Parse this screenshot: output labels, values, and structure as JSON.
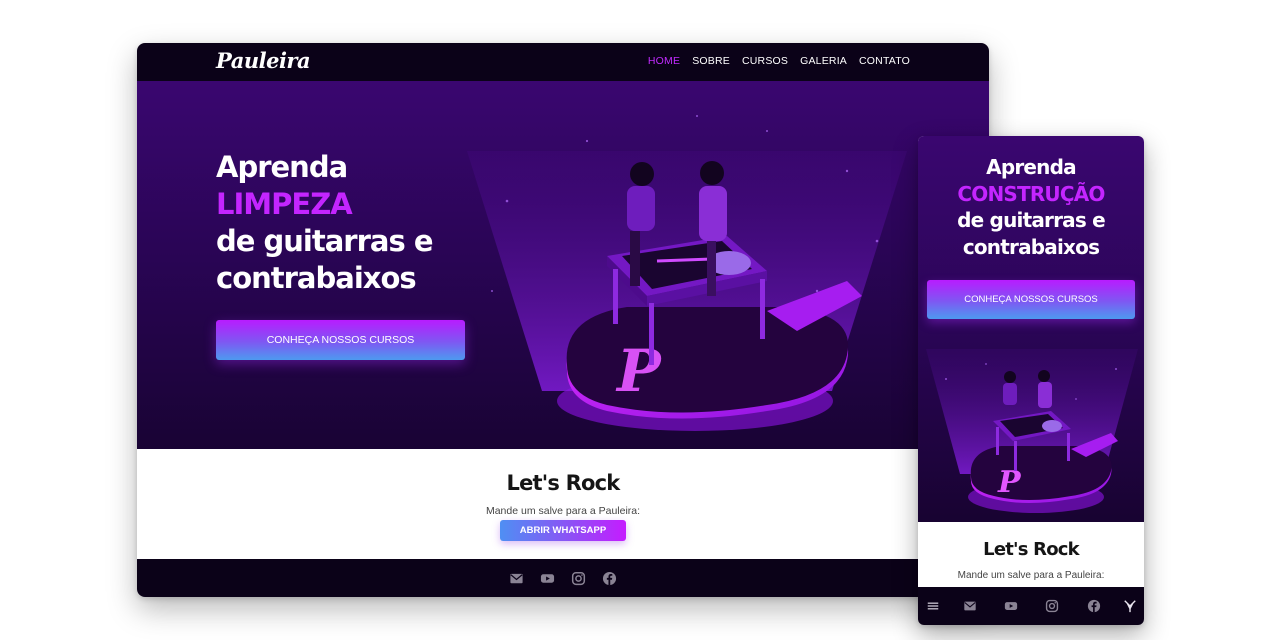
{
  "desktop": {
    "brand": "Pauleira",
    "nav": [
      {
        "label": "HOME",
        "active": true
      },
      {
        "label": "SOBRE",
        "active": false
      },
      {
        "label": "CURSOS",
        "active": false
      },
      {
        "label": "GALERIA",
        "active": false
      },
      {
        "label": "CONTATO",
        "active": false
      }
    ],
    "hero": {
      "line1": "Aprenda",
      "highlight": "LIMPEZA",
      "line3": "de guitarras e",
      "line4": "contrabaixos",
      "cta": "CONHEÇA NOSSOS CURSOS"
    },
    "contact": {
      "title": "Let's Rock",
      "subtitle": "Mande um salve para a Pauleira:",
      "button": "ABRIR WHATSAPP"
    },
    "footer_icons": [
      "mail-icon",
      "youtube-icon",
      "instagram-icon",
      "facebook-icon"
    ]
  },
  "mobile": {
    "hero": {
      "line1": "Aprenda",
      "highlight": "CONSTRUÇÃO",
      "line3": "de guitarras e",
      "line4": "contrabaixos",
      "cta": "CONHEÇA NOSSOS CURSOS"
    },
    "contact": {
      "title": "Let's Rock",
      "subtitle": "Mande um salve para a Pauleira:"
    },
    "footer_icons": [
      "menu-icon",
      "mail-icon",
      "youtube-icon",
      "instagram-icon",
      "facebook-icon",
      "brand-mark-icon"
    ]
  },
  "colors": {
    "accent": "#c425ff",
    "nav_bg": "#0b0218",
    "hero_top": "#3a0670",
    "hero_bottom": "#190334",
    "cta_gradient": [
      "#b81cff",
      "#4d9af0"
    ]
  }
}
